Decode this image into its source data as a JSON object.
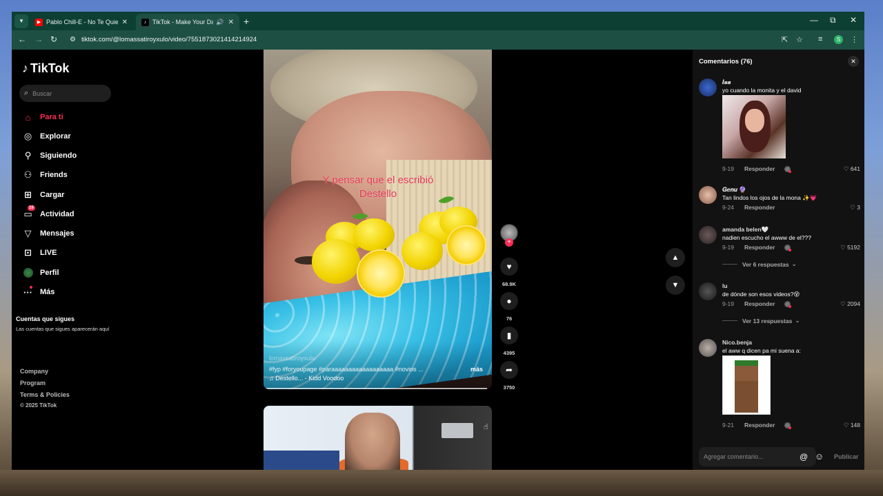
{
  "browser": {
    "tabs": [
      {
        "title": "Pablo Chill-E - No Te Quieren V...",
        "favicon": "youtube-icon"
      },
      {
        "title": "TikTok - Make Your Day",
        "favicon": "tiktok-icon"
      }
    ],
    "url": "tiktok.com/@lomassatiroyxulo/video/7551873021414214924",
    "profile_letter": "S"
  },
  "sidebar": {
    "logo": "TikTok",
    "search_placeholder": "Buscar",
    "nav": [
      {
        "label": "Para ti",
        "icon": "home-icon",
        "active": true
      },
      {
        "label": "Explorar",
        "icon": "compass-icon"
      },
      {
        "label": "Siguiendo",
        "icon": "following-icon"
      },
      {
        "label": "Friends",
        "icon": "friends-icon"
      },
      {
        "label": "Cargar",
        "icon": "upload-icon"
      },
      {
        "label": "Actividad",
        "icon": "activity-icon",
        "badge": "19"
      },
      {
        "label": "Mensajes",
        "icon": "messages-icon"
      },
      {
        "label": "LIVE",
        "icon": "live-icon"
      },
      {
        "label": "Perfil",
        "icon": "profile-icon"
      },
      {
        "label": "Más",
        "icon": "more-icon"
      }
    ],
    "following_title": "Cuentas que sigues",
    "following_desc": "Las cuentas que sigues aparecerán aquí",
    "footer": [
      "Company",
      "Program",
      "Terms & Policies"
    ],
    "copyright": "© 2025 TikTok"
  },
  "video": {
    "overlay_text": "Y pensar que el escribió Destello",
    "username": "lomassatiroyxulo",
    "tags": "#fyp #foryoupage #paraaaaaaaaaaaaaaaaaa #novios ...",
    "more_label": "más",
    "sound": "♫ Destello... - Kidd Voodoo",
    "progress": 0.98,
    "likes": "68.9K",
    "comments": "76",
    "saves": "4395",
    "shares": "3750"
  },
  "comments": {
    "title": "Comentarios (76)",
    "items": [
      {
        "user": "𝑰𝒔𝒂",
        "text": "yo cuando la monita y el david",
        "date": "9-19",
        "reply": "Responder",
        "likes": "641",
        "has_image": true
      },
      {
        "user": "𝑮𝒆𝒏𝒖 🔮",
        "text": "Tan lindos los ojos de la mona ✨💗",
        "date": "9-24",
        "reply": "Responder",
        "likes": "3"
      },
      {
        "user": "amanda belen🤍",
        "text": "nadien escucho el awww de el???",
        "date": "9-19",
        "reply": "Responder",
        "likes": "5192",
        "replies": "Ver 6 respuestas"
      },
      {
        "user": "lu",
        "text": "de dónde son esos videos?😵",
        "date": "9-19",
        "reply": "Responder",
        "likes": "2094",
        "replies": "Ver 13 respuestas"
      },
      {
        "user": "Nico.benja",
        "text": "el aww q dicen pa mi suena a:",
        "date": "9-21",
        "reply": "Responder",
        "likes": "148",
        "has_image": true
      }
    ],
    "input_placeholder": "Agregar comentario...",
    "post_label": "Publicar"
  }
}
